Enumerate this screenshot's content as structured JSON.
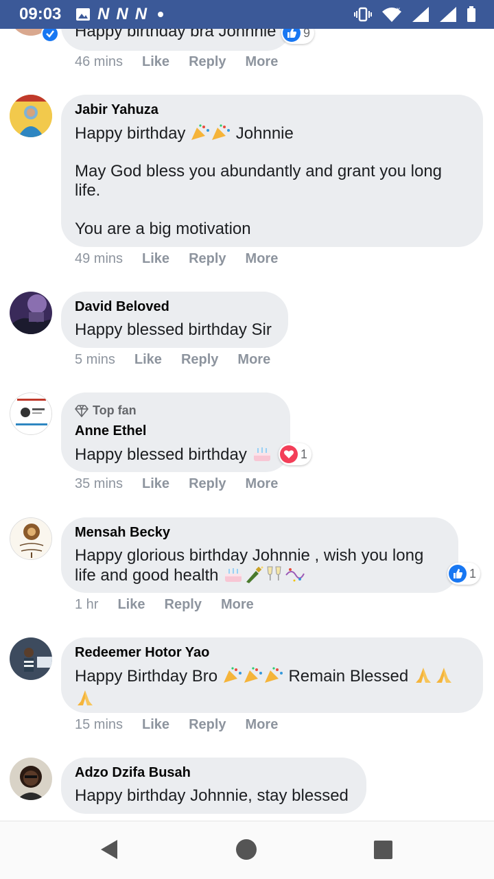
{
  "status_bar": {
    "time": "09:03",
    "notif_letters": [
      "N",
      "N",
      "N"
    ]
  },
  "comments": [
    {
      "name": "",
      "text": "Happy birthday bra Johnnie",
      "time": "46 mins",
      "like": "Like",
      "reply": "Reply",
      "more": "More",
      "reaction": {
        "type": "like",
        "count": "9"
      }
    },
    {
      "name": "Jabir Yahuza",
      "text1": "Happy birthday",
      "text1b": "Johnnie",
      "text2": "May God bless you abundantly and grant you long life.",
      "text3": "You are a big motivation",
      "time": "49 mins",
      "like": "Like",
      "reply": "Reply",
      "more": "More"
    },
    {
      "name": "David Beloved",
      "text": "Happy blessed birthday Sir",
      "time": "5 mins",
      "like": "Like",
      "reply": "Reply",
      "more": "More"
    },
    {
      "badge": "Top fan",
      "name": "Anne Ethel",
      "text": "Happy blessed birthday",
      "time": "35 mins",
      "like": "Like",
      "reply": "Reply",
      "more": "More",
      "reaction": {
        "type": "love",
        "count": "1"
      }
    },
    {
      "name": "Mensah Becky",
      "text": "Happy glorious birthday Johnnie , wish you long life and good health",
      "time": "1 hr",
      "like": "Like",
      "reply": "Reply",
      "more": "More",
      "reaction": {
        "type": "like",
        "count": "1"
      }
    },
    {
      "name": "Redeemer Hotor Yao",
      "text1": "Happy Birthday Bro",
      "text1b": "Remain Blessed",
      "time": "15 mins",
      "like": "Like",
      "reply": "Reply",
      "more": "More"
    },
    {
      "name": "Adzo Dzifa Busah",
      "text": "Happy birthday Johnnie, stay blessed"
    }
  ],
  "colors": {
    "header": "#3b5998",
    "bubble": "#ebedf0",
    "like_blue": "#1877f2",
    "love_red": "#f33e58"
  },
  "nav": {
    "back": "back-icon",
    "home": "home-icon",
    "recents": "recents-icon"
  }
}
